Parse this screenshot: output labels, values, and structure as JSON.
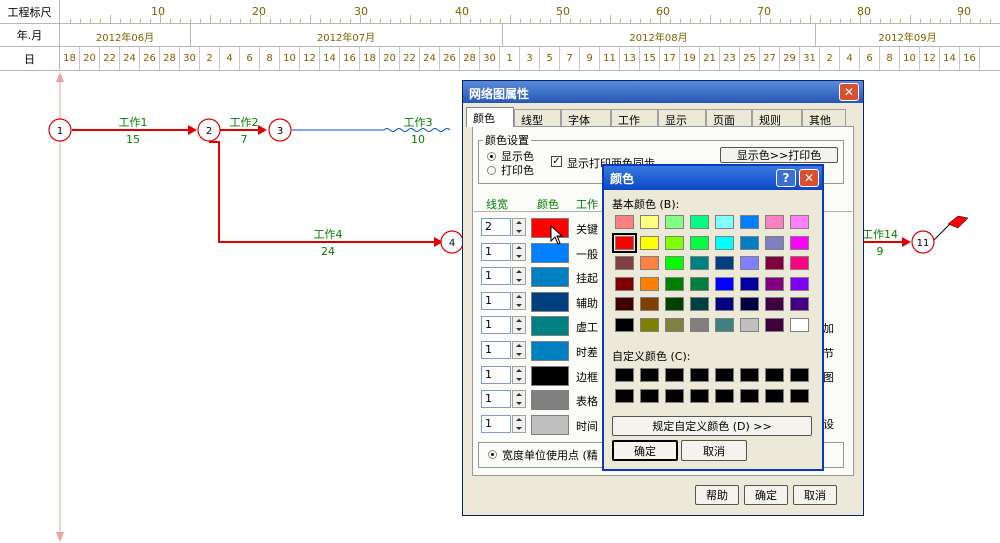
{
  "ruler": {
    "scale_label": "工程标尺",
    "month_label": "年.月",
    "day_label": "日",
    "scale_ticks": [
      "10",
      "20",
      "30",
      "40",
      "50",
      "60",
      "70",
      "80",
      "90"
    ],
    "months": [
      "2012年06月",
      "2012年07月",
      "2012年08月",
      "2012年09月"
    ],
    "days": [
      "18",
      "20",
      "22",
      "24",
      "26",
      "28",
      "30",
      "2",
      "4",
      "6",
      "8",
      "10",
      "12",
      "14",
      "16",
      "18",
      "20",
      "22",
      "24",
      "26",
      "28",
      "30",
      "1",
      "3",
      "5",
      "7",
      "9",
      "11",
      "13",
      "15",
      "17",
      "19",
      "21",
      "23",
      "25",
      "27",
      "29",
      "31",
      "2",
      "4",
      "6",
      "8",
      "10",
      "12",
      "14",
      "16"
    ]
  },
  "network": {
    "nodes": [
      "1",
      "2",
      "3",
      "4",
      "11"
    ],
    "tasks": [
      {
        "label": "工作1",
        "duration": "15"
      },
      {
        "label": "工作2",
        "duration": "7"
      },
      {
        "label": "工作3",
        "duration": "10"
      },
      {
        "label": "工作4",
        "duration": "24"
      },
      {
        "label": "工作14",
        "duration": "9"
      }
    ],
    "colors": {
      "critical": "#e00000",
      "normal": "#0050d0"
    }
  },
  "props_dialog": {
    "title": "网络图属性",
    "tabs": [
      "颜色",
      "线型",
      "字体",
      "工作",
      "显示",
      "页面",
      "规则",
      "其他"
    ],
    "active_tab": "颜色",
    "group_title": "颜色设置",
    "radio_display": "显示色",
    "radio_print": "打印色",
    "sync_checkbox": "显示打印两色同步",
    "display_to_print_btn": "显示色>>打印色",
    "col_width": "线宽",
    "col_color": "颜色",
    "col_work": "工作",
    "rows": [
      {
        "width": "2",
        "color": "#ff0000",
        "label": "关键"
      },
      {
        "width": "1",
        "color": "#0080ff",
        "label": "一般"
      },
      {
        "width": "1",
        "color": "#0080c0",
        "label": "挂起"
      },
      {
        "width": "1",
        "color": "#004080",
        "label": "辅助"
      },
      {
        "width": "1",
        "color": "#008080",
        "label": "虚工"
      },
      {
        "width": "1",
        "color": "#0080c0",
        "label": "时差"
      },
      {
        "width": "1",
        "color": "#000000",
        "label": "边框"
      },
      {
        "width": "1",
        "color": "#808080",
        "label": "表格"
      },
      {
        "width": "1",
        "color": "#c0c0c0",
        "label": "时间"
      }
    ],
    "right_fragments": [
      "加",
      "节",
      "图",
      "设"
    ],
    "unit_radio": "宽度单位使用点 (精",
    "help_btn": "帮助",
    "ok_btn": "确定",
    "cancel_btn": "取消"
  },
  "color_dialog": {
    "title": "颜色",
    "basic_label": "基本颜色 (B):",
    "custom_label": "自定义颜色 (C):",
    "define_btn": "规定自定义颜色 (D) >>",
    "ok_btn": "确定",
    "cancel_btn": "取消",
    "basic_colors": [
      [
        "#ff8080",
        "#ffff80",
        "#80ff80",
        "#00ff80",
        "#80ffff",
        "#0080ff",
        "#ff80c0",
        "#ff80ff"
      ],
      [
        "#ff0000",
        "#ffff00",
        "#80ff00",
        "#00ff40",
        "#00ffff",
        "#0080c0",
        "#8080c0",
        "#ff00ff"
      ],
      [
        "#804040",
        "#ff8040",
        "#00ff00",
        "#008080",
        "#004080",
        "#8080ff",
        "#800040",
        "#ff0080"
      ],
      [
        "#800000",
        "#ff8000",
        "#008000",
        "#008040",
        "#0000ff",
        "#0000a0",
        "#800080",
        "#8000ff"
      ],
      [
        "#400000",
        "#804000",
        "#004000",
        "#004040",
        "#000080",
        "#000040",
        "#400040",
        "#400080"
      ],
      [
        "#000000",
        "#808000",
        "#808040",
        "#808080",
        "#408080",
        "#c0c0c0",
        "#400040",
        "#ffffff"
      ]
    ],
    "selected": "#ff0000"
  }
}
